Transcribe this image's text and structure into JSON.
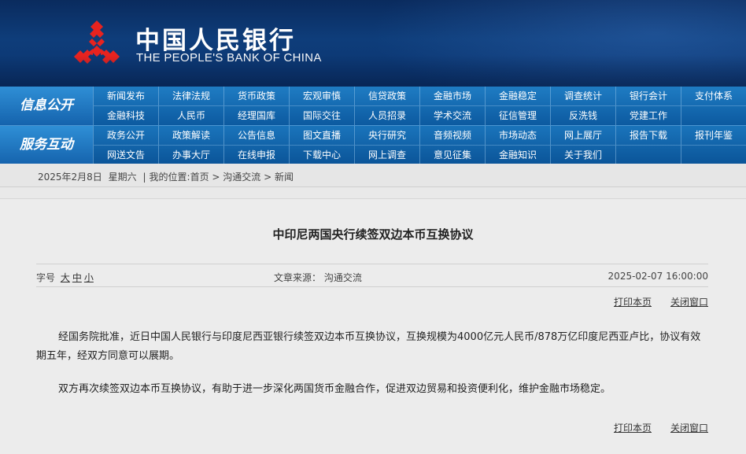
{
  "header": {
    "bank_name_cn": "中国人民银行",
    "bank_name_en": "THE PEOPLE'S BANK OF CHINA",
    "logo_icon": "pboc-logo-icon",
    "logo_color": "#e8231f"
  },
  "nav": {
    "group1": {
      "label": "信息公开",
      "row1": [
        "新闻发布",
        "法律法规",
        "货币政策",
        "宏观审慎",
        "信贷政策",
        "金融市场",
        "金融稳定",
        "调查统计",
        "银行会计",
        "支付体系"
      ],
      "row2": [
        "金融科技",
        "人民币",
        "经理国库",
        "国际交往",
        "人员招录",
        "学术交流",
        "征信管理",
        "反洗钱",
        "党建工作"
      ]
    },
    "group2": {
      "label": "服务互动",
      "row1": [
        "政务公开",
        "政策解读",
        "公告信息",
        "图文直播",
        "央行研究",
        "音频视频",
        "市场动态",
        "网上展厅",
        "报告下载",
        "报刊年鉴"
      ],
      "row2": [
        "网送文告",
        "办事大厅",
        "在线申报",
        "下载中心",
        "网上调查",
        "意见征集",
        "金融知识",
        "关于我们"
      ]
    }
  },
  "breadcrumb": {
    "date": "2025年2月8日",
    "weekday": "星期六",
    "separator": "|",
    "location_label": "我的位置:",
    "path": "首页 > 沟通交流 > 新闻"
  },
  "article": {
    "title": "中印尼两国央行续签双边本币互换协议",
    "font_size_label": "字号",
    "font_sizes": [
      "大",
      "中",
      "小"
    ],
    "source": "文章来源：  沟通交流",
    "date": "2025-02-07 16:00:00",
    "print_label": "打印本页",
    "close_label": "关闭窗口",
    "paragraphs": [
      "经国务院批准，近日中国人民银行与印度尼西亚银行续签双边本币互换协议，互换规模为4000亿元人民币/878万亿印度尼西亚卢比，协议有效期五年，经双方同意可以展期。",
      "双方再次续签双边本币互换协议，有助于进一步深化两国货币金融合作，促进双边贸易和投资便利化，维护金融市场稳定。"
    ]
  }
}
